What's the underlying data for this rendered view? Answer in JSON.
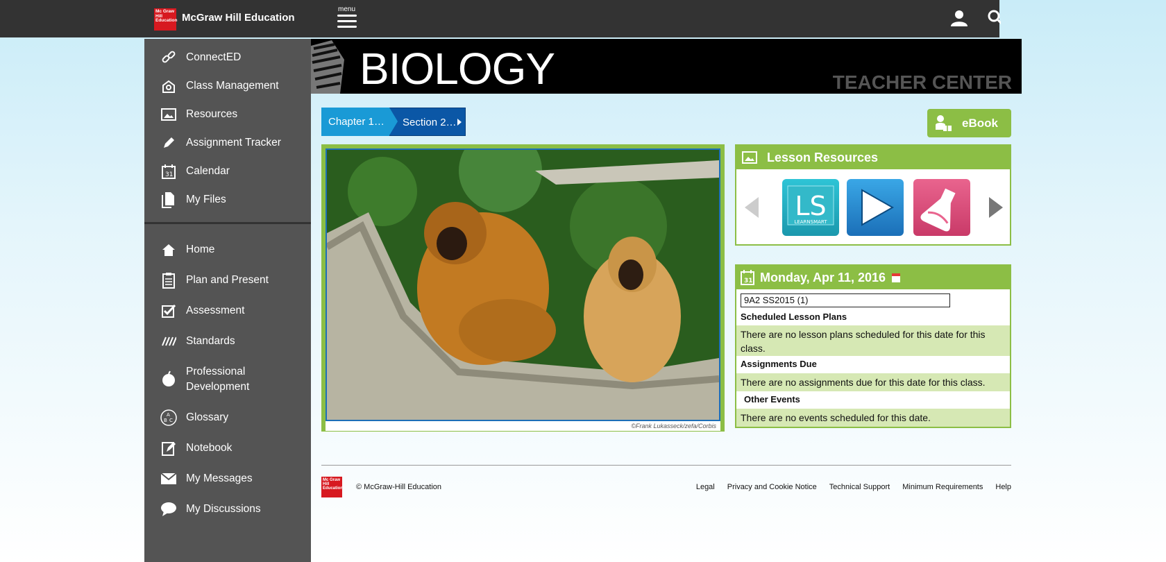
{
  "header": {
    "logo_text": "Mc Graw Hill Education",
    "brand": "McGraw Hill Education",
    "menu_label": "menu"
  },
  "sidebar": {
    "top_items": [
      {
        "label": "ConnectED",
        "icon": "link-icon"
      },
      {
        "label": "Class Management",
        "icon": "class-management-icon"
      },
      {
        "label": "Resources",
        "icon": "image-icon"
      },
      {
        "label": "Assignment Tracker",
        "icon": "pencil-icon"
      },
      {
        "label": "Calendar",
        "icon": "calendar-icon"
      },
      {
        "label": "My Files",
        "icon": "files-icon"
      }
    ],
    "bottom_items": [
      {
        "label": "Home",
        "icon": "home-icon"
      },
      {
        "label": "Plan and Present",
        "icon": "clipboard-icon"
      },
      {
        "label": "Assessment",
        "icon": "checkbox-icon"
      },
      {
        "label": "Standards",
        "icon": "standards-icon"
      },
      {
        "label": "Professional\nDevelopment",
        "icon": "apple-icon"
      },
      {
        "label": "Glossary",
        "icon": "abc-icon"
      },
      {
        "label": "Notebook",
        "icon": "notebook-icon"
      },
      {
        "label": "My Messages",
        "icon": "envelope-icon"
      },
      {
        "label": "My Discussions",
        "icon": "chat-bubble-icon"
      }
    ]
  },
  "banner": {
    "title": "BIOLOGY",
    "subtitle": "TEACHER CENTER"
  },
  "breadcrumb": {
    "chapter": "Chapter 1…",
    "section": "Section 2…"
  },
  "ebook": {
    "label": "eBook"
  },
  "photo": {
    "credit": "©Frank Lukasseck/zefa/Corbis"
  },
  "lesson_resources": {
    "title": "Lesson Resources",
    "tiles": [
      {
        "name": "LearnSmart",
        "text_big": "LS",
        "text_small": "LEARNSMART"
      },
      {
        "name": "Video",
        "icon": "play-icon"
      },
      {
        "name": "Lab",
        "icon": "flask-icon"
      }
    ]
  },
  "calendar": {
    "date": "Monday, Apr 11, 2016",
    "class_select": "9A2 SS2015 (1)",
    "scheduled_label": "Scheduled Lesson Plans",
    "scheduled_msg": "There are no lesson plans scheduled for this date for this class.",
    "assignments_label": "Assignments Due",
    "assignments_msg": "There are no assignments due for this date for this class.",
    "events_label": "Other Events",
    "events_msg": "There are no events scheduled for this date."
  },
  "footer": {
    "logo_text": "Mc Graw Hill Education",
    "copyright": "© McGraw-Hill Education",
    "links": [
      "Legal",
      "Privacy and Cookie Notice",
      "Technical Support",
      "Minimum Requirements",
      "Help"
    ]
  },
  "colors": {
    "accent_green": "#8cbe45",
    "breadcrumb_light": "#1a9ad6",
    "breadcrumb_dark": "#0b57a6",
    "brand_red": "#d71920"
  }
}
